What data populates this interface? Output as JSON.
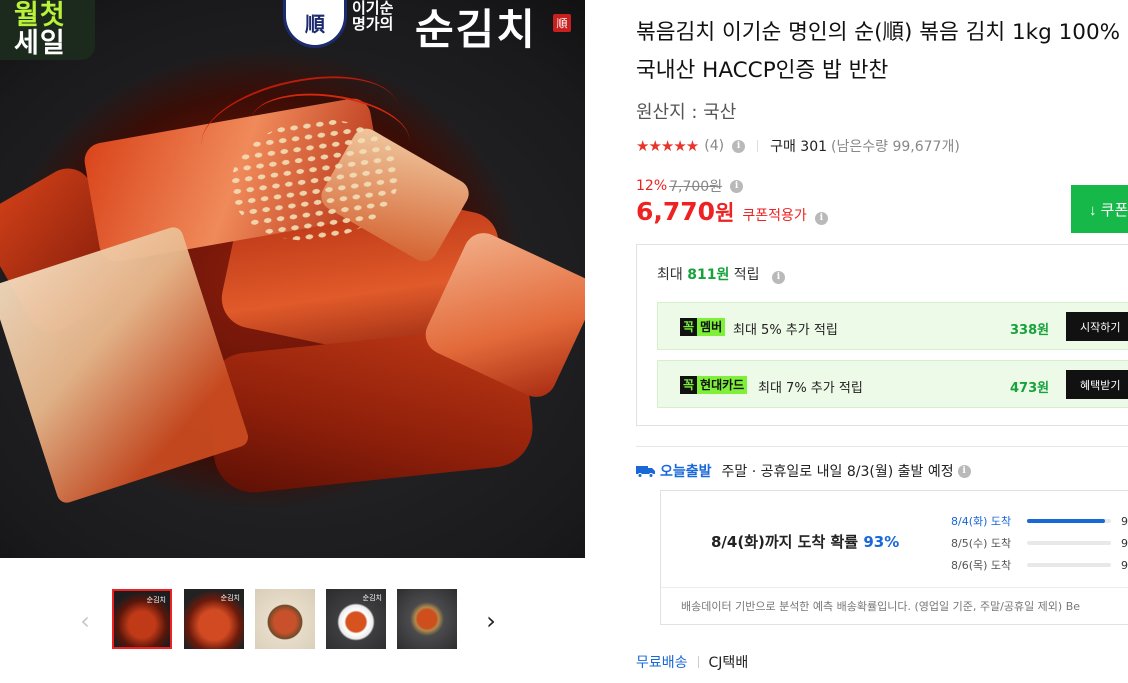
{
  "gallery": {
    "badge_line1": "월첫",
    "badge_line2": "세일",
    "seal_char": "順",
    "brand_small": "이기순 명가의",
    "brand_name": "순김치",
    "brand_stamp": "順",
    "prev_glyph": "‹",
    "next_glyph": "›",
    "thumbnails": [
      {
        "selected": true,
        "mini_logo": "순김치"
      },
      {
        "selected": false,
        "mini_logo": "순김치"
      },
      {
        "selected": false,
        "mini_logo": ""
      },
      {
        "selected": false,
        "mini_logo": "순김치"
      },
      {
        "selected": false,
        "mini_logo": ""
      }
    ]
  },
  "product": {
    "title": "볶음김치 이기순 명인의 순(順) 볶음 김치 1kg 100%국내산 HACCP인증 밥 반찬",
    "origin": "원산지 : 국산",
    "stars": "★★★★★",
    "rating_value": 5,
    "review_count": "(4)",
    "purchase_count": "구매 301",
    "remaining": "(남은수량 99,677개)"
  },
  "price": {
    "discount_rate": "12%",
    "original_price": "7,700원",
    "sale_price": "6,770",
    "currency": "원",
    "coupon_note": "쿠폰적용가",
    "coupon_button": "↓ 쿠폰",
    "coupon_color": "#16b84a",
    "accent_color": "#e22222"
  },
  "points": {
    "title_prefix": "최대 ",
    "title_amount": "811원",
    "title_suffix": " 적립",
    "benefits": [
      {
        "tag_k": "꼭",
        "tag_name": "멤버",
        "desc": "최대 5% 추가 적립",
        "amount": "338원",
        "action": "시작하기"
      },
      {
        "tag_k": "꼭",
        "tag_name": "현대카드",
        "desc": "최대 7% 추가 적립",
        "amount": "473원",
        "action": "혜택받기"
      }
    ]
  },
  "shipping": {
    "label": "오늘출발",
    "text": "주말 · 공휴일로 내일 8/3(월) 출발 예정",
    "arrival_main": "8/4(화)까지 도착 확률 ",
    "arrival_pct": "93%",
    "forecast": [
      {
        "label": "8/4(화) 도착",
        "fraction": 0.93,
        "value": "9"
      },
      {
        "label": "8/5(수) 도착",
        "fraction": 0.0,
        "value": "9"
      },
      {
        "label": "8/6(목) 도착",
        "fraction": 0.0,
        "value": "9"
      }
    ],
    "note": "배송데이터 기반으로 분석한 예측 배송확률입니다. (영업일 기준, 주말/공휴일 제외) Be",
    "free_label": "무료배송",
    "carrier": "CJ택배",
    "accent_color": "#1868d8"
  }
}
